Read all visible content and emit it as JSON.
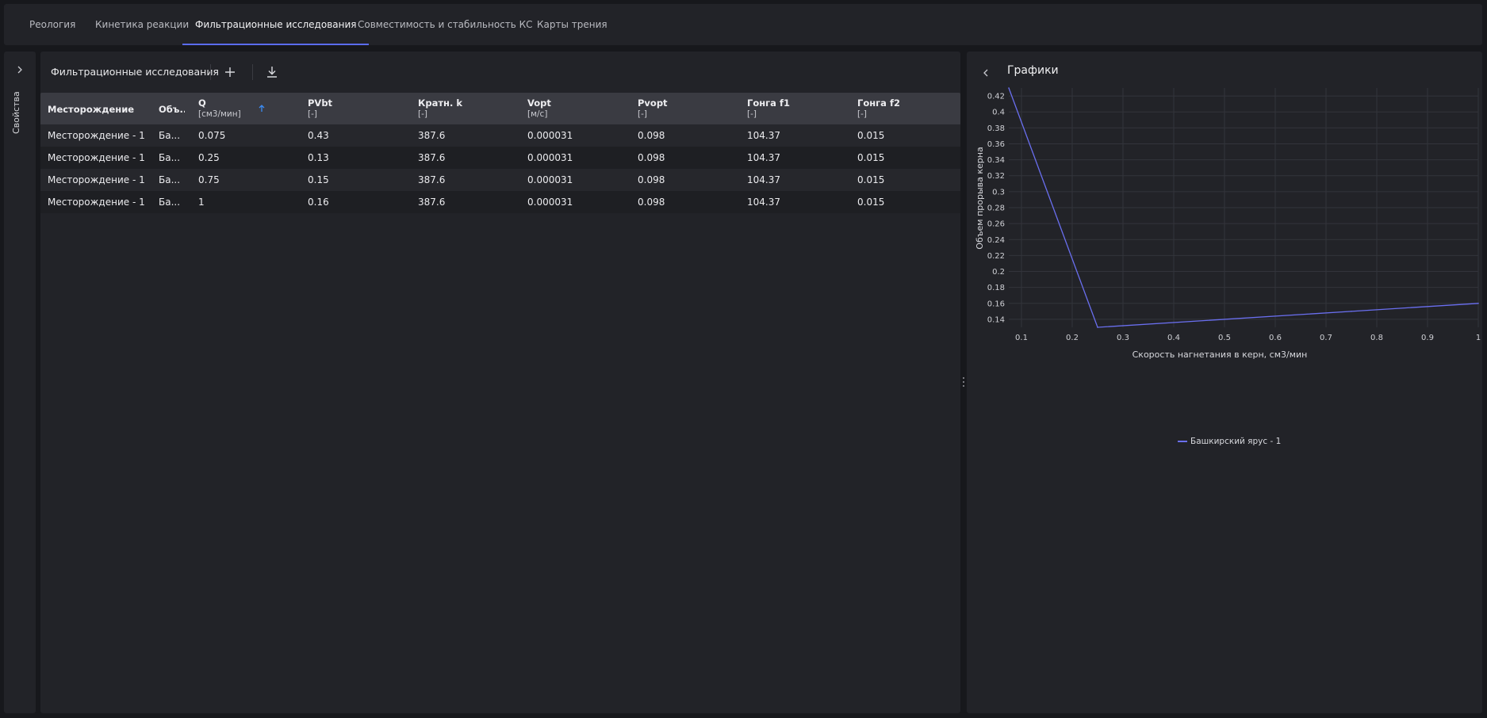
{
  "tabs": [
    {
      "label": "Реология",
      "active": false
    },
    {
      "label": "Кинетика реакции",
      "active": false
    },
    {
      "label": "Фильтрационные исследования",
      "active": true
    },
    {
      "label": "Совместимость и стабильность КС",
      "active": false
    },
    {
      "label": "Карты трения",
      "active": false
    }
  ],
  "rail": {
    "label": "Свойства"
  },
  "toolbar": {
    "title": "Фильтрационные исследования",
    "add_icon": "plus-icon",
    "download_icon": "download-icon"
  },
  "table": {
    "columns": [
      {
        "label": "Месторождение",
        "unit": ""
      },
      {
        "label": "Объ...",
        "unit": ""
      },
      {
        "label": "Q",
        "unit": "[см3/мин]"
      },
      {
        "label": "PVbt",
        "unit": "[-]"
      },
      {
        "label": "Кратн. k",
        "unit": "[-]"
      },
      {
        "label": "Vopt",
        "unit": "[м/с]"
      },
      {
        "label": "Pvopt",
        "unit": "[-]"
      },
      {
        "label": "Гонга f1",
        "unit": "[-]"
      },
      {
        "label": "Гонга f2",
        "unit": "[-]"
      }
    ],
    "sort_icon": "arrow-up-icon",
    "rows": [
      [
        "Месторождение - 1",
        "Ба...",
        "0.075",
        "0.43",
        "387.6",
        "0.000031",
        "0.098",
        "104.37",
        "0.015"
      ],
      [
        "Месторождение - 1",
        "Ба...",
        "0.25",
        "0.13",
        "387.6",
        "0.000031",
        "0.098",
        "104.37",
        "0.015"
      ],
      [
        "Месторождение - 1",
        "Ба...",
        "0.75",
        "0.15",
        "387.6",
        "0.000031",
        "0.098",
        "104.37",
        "0.015"
      ],
      [
        "Месторождение - 1",
        "Ба...",
        "1",
        "0.16",
        "387.6",
        "0.000031",
        "0.098",
        "104.37",
        "0.015"
      ]
    ]
  },
  "charts_panel": {
    "title": "Графики",
    "back_icon": "chevron-left-icon"
  },
  "chart_data": {
    "type": "line",
    "title": "",
    "xlabel": "Скорость нагнетания в керн, см3/мин",
    "ylabel": "Объем прорыва керна",
    "x_ticks": [
      "0.1",
      "0.2",
      "0.3",
      "0.4",
      "0.5",
      "0.6",
      "0.7",
      "0.8",
      "0.9",
      "1"
    ],
    "y_ticks": [
      "0.14",
      "0.16",
      "0.18",
      "0.2",
      "0.22",
      "0.24",
      "0.26",
      "0.28",
      "0.3",
      "0.32",
      "0.34",
      "0.36",
      "0.38",
      "0.4",
      "0.42"
    ],
    "xlim": [
      0.075,
      1
    ],
    "ylim": [
      0.13,
      0.43
    ],
    "grid": true,
    "legend_position": "bottom-center",
    "series": [
      {
        "name": "Башкирский ярус - 1",
        "color": "#6a6ff0",
        "x": [
          0.075,
          0.25,
          0.75,
          1
        ],
        "y": [
          0.43,
          0.13,
          0.15,
          0.16
        ]
      }
    ]
  },
  "colors": {
    "accent": "#5b6cf2",
    "series": "#6a6ff0",
    "sort": "#3b8cf5"
  }
}
